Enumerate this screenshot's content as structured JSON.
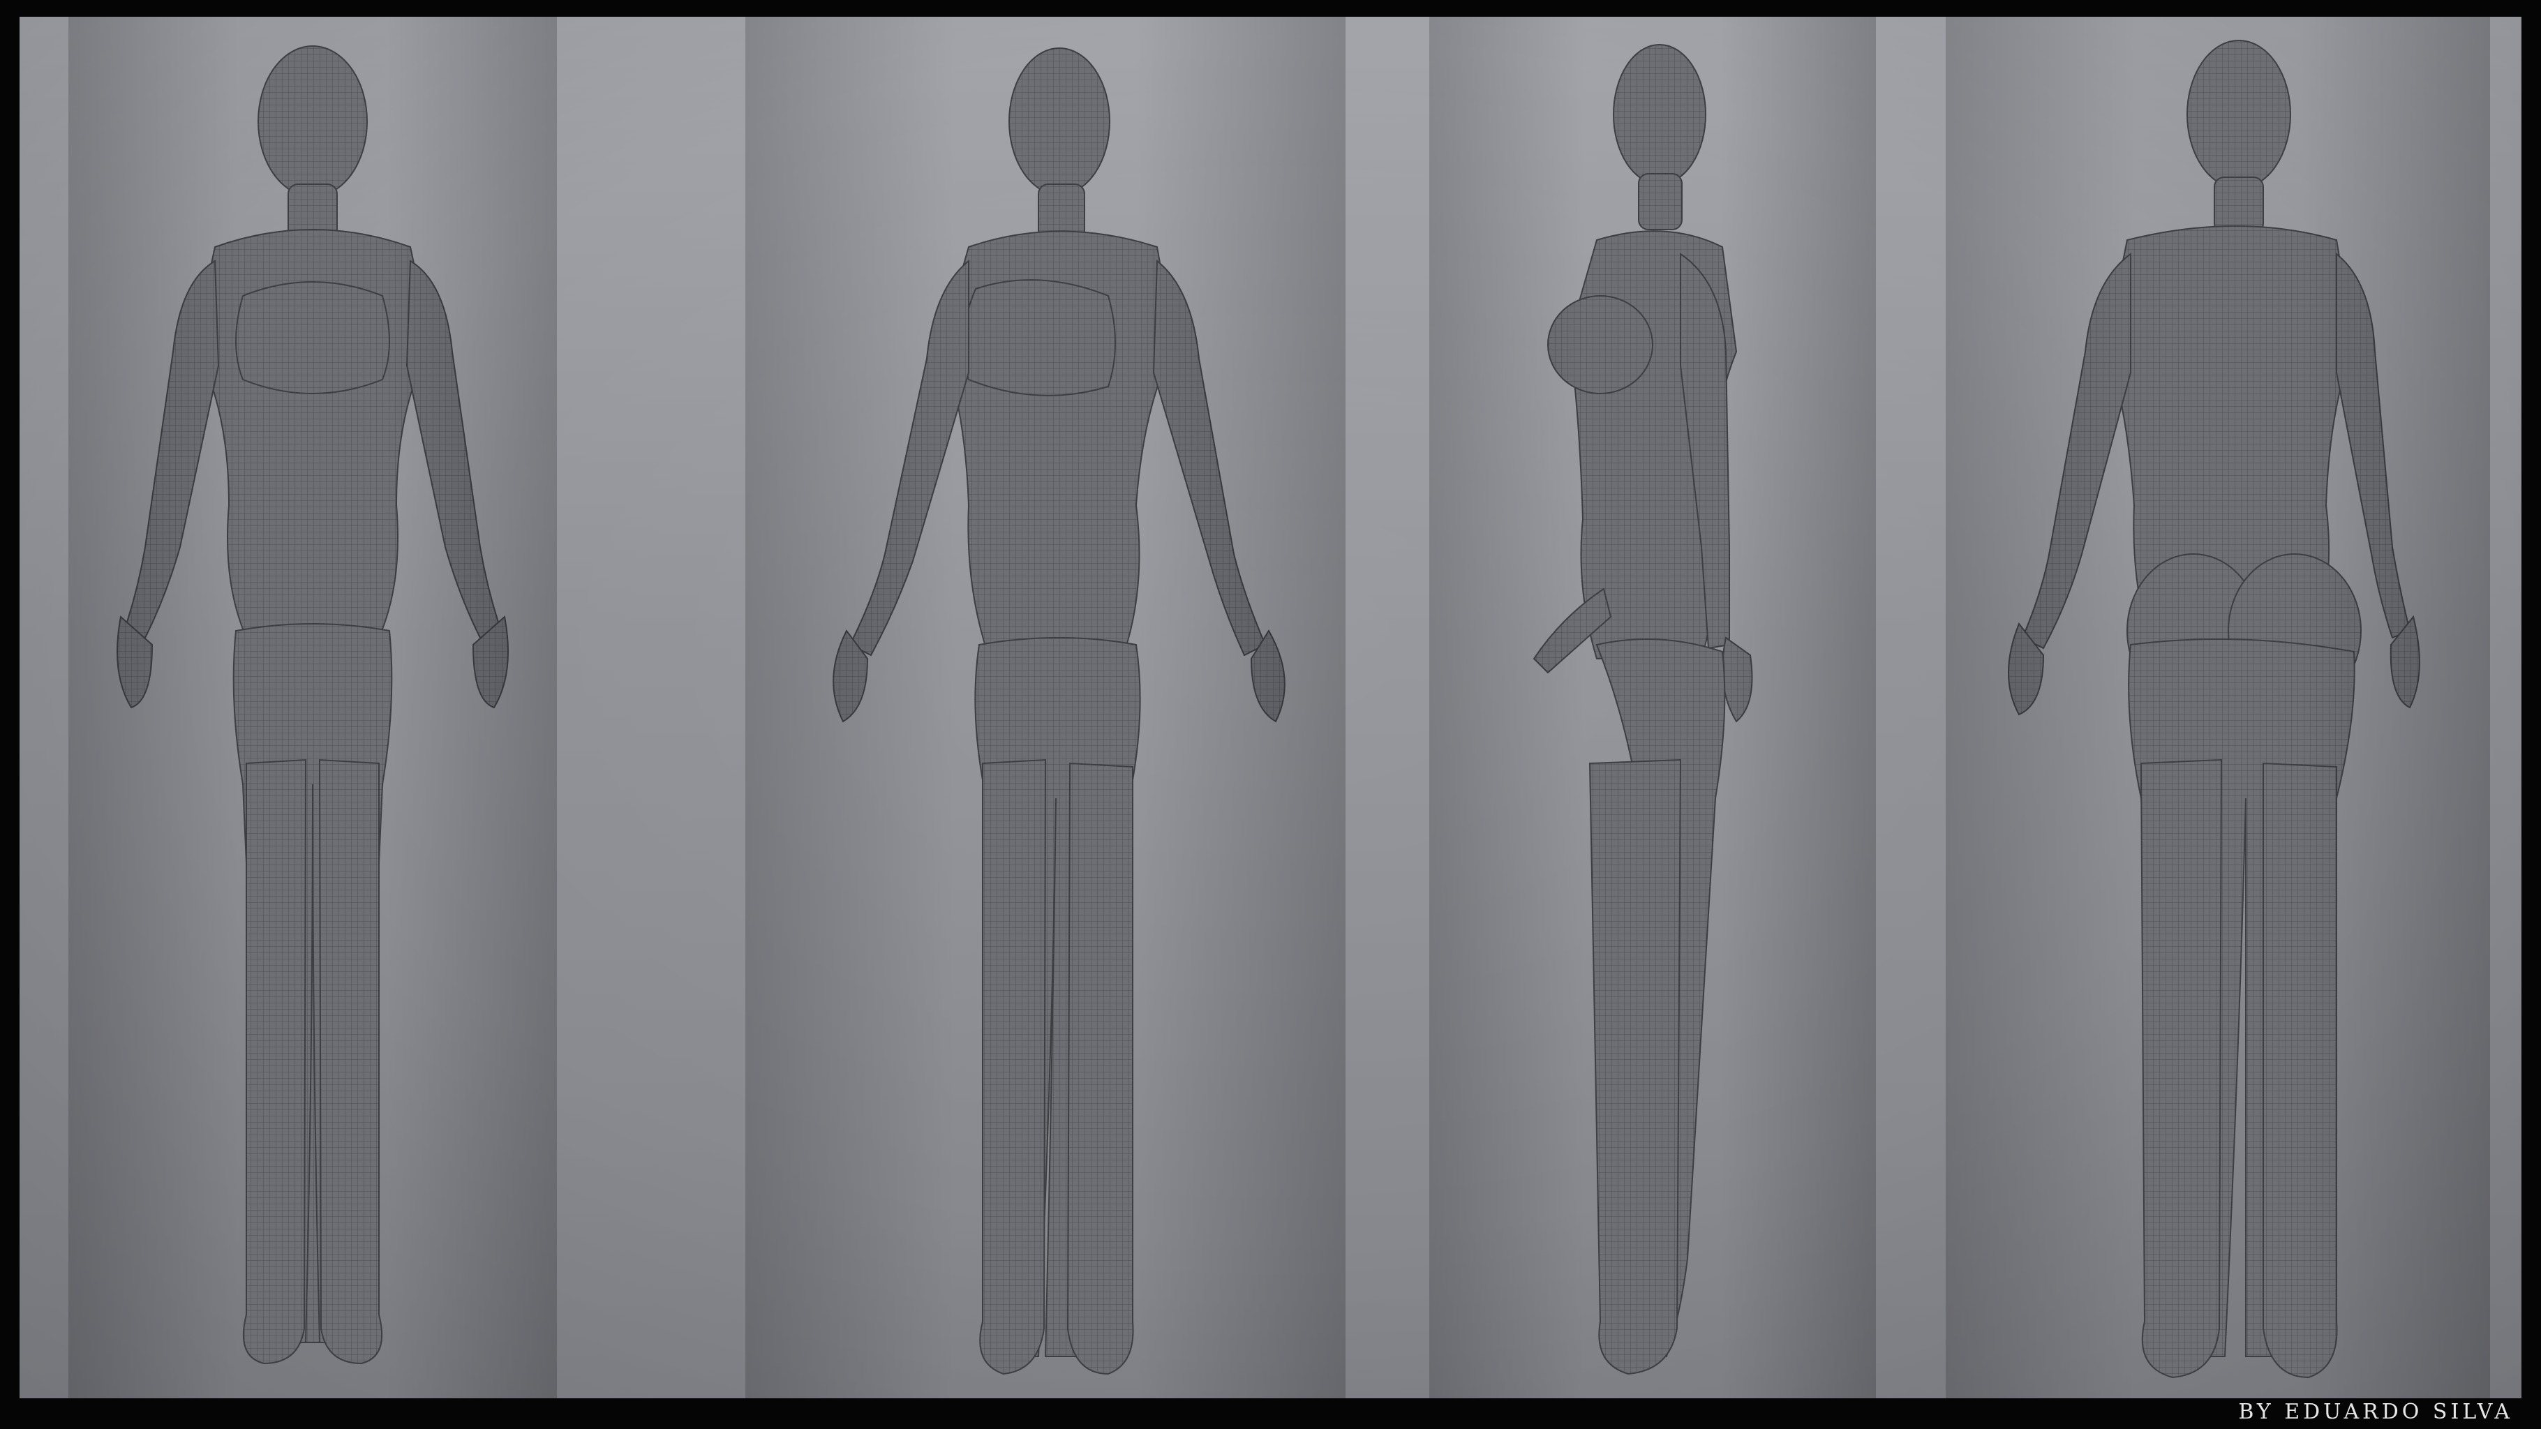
{
  "credit": {
    "text": "BY EDUARDO SILVA"
  },
  "colors": {
    "background_top": "#a3a5ab",
    "background_bottom": "#84868c",
    "model_base": "#6e7076",
    "model_shadow": "#55575c",
    "wire": "#4a4c51",
    "border": "#050505"
  },
  "views": [
    "front",
    "three-quarter",
    "side",
    "back"
  ]
}
